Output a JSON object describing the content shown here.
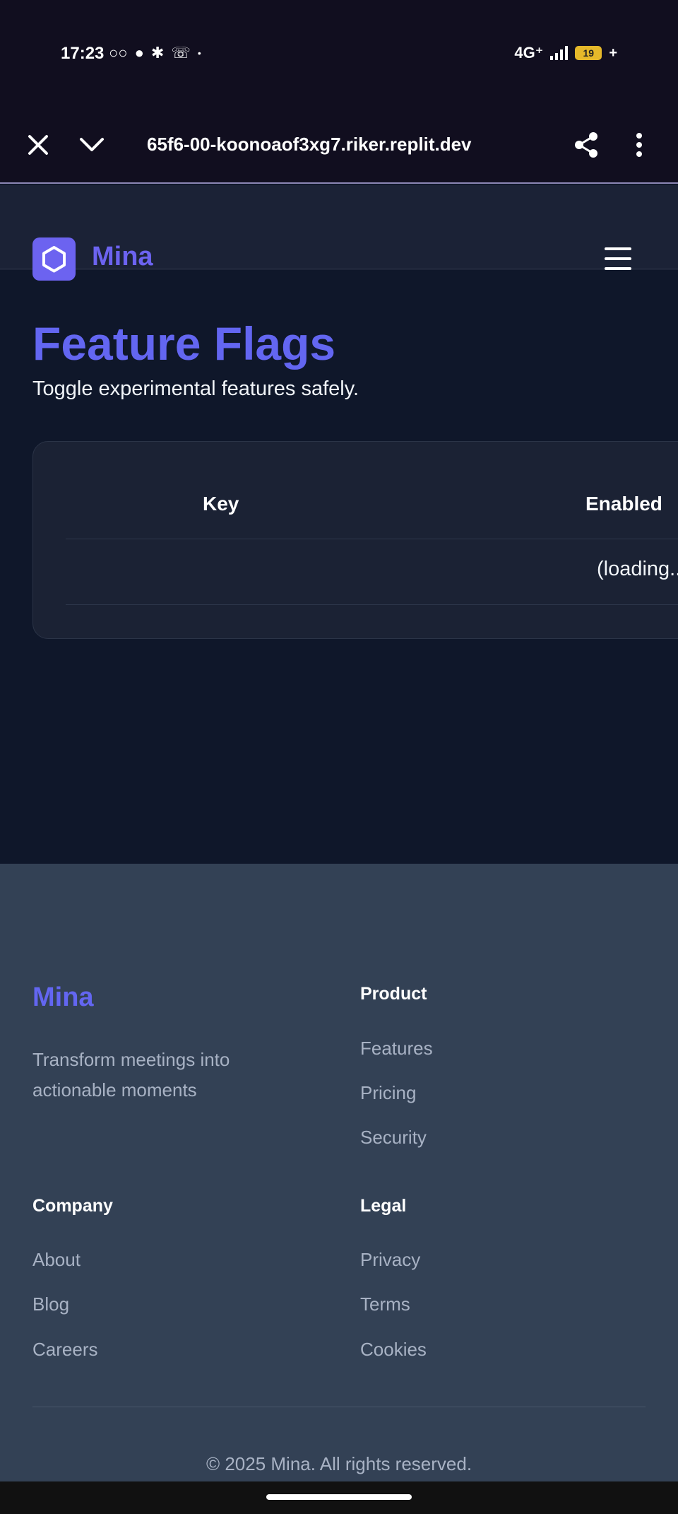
{
  "status_bar": {
    "time": "17:23",
    "network": "4G⁺",
    "battery": "19"
  },
  "browser": {
    "url": "65f6-00-koonoaof3xg7.riker.replit.dev"
  },
  "header": {
    "brand": "Mina"
  },
  "main": {
    "title": "Feature Flags",
    "subtitle": "Toggle experimental features safely.",
    "table": {
      "columns": [
        "Key",
        "Enabled"
      ],
      "rows": [
        [
          "",
          "(loading..."
        ]
      ]
    }
  },
  "footer": {
    "brand": "Mina",
    "tagline": "Transform meetings into actionable moments",
    "product": {
      "heading": "Product",
      "links": [
        "Features",
        "Pricing",
        "Security"
      ]
    },
    "company": {
      "heading": "Company",
      "links": [
        "About",
        "Blog",
        "Careers"
      ]
    },
    "legal": {
      "heading": "Legal",
      "links": [
        "Privacy",
        "Terms",
        "Cookies"
      ]
    },
    "copyright": "© 2025 Mina. All rights reserved."
  },
  "colors": {
    "accent": "#6366f1",
    "background": "#0f172a",
    "footer": "#334155"
  }
}
